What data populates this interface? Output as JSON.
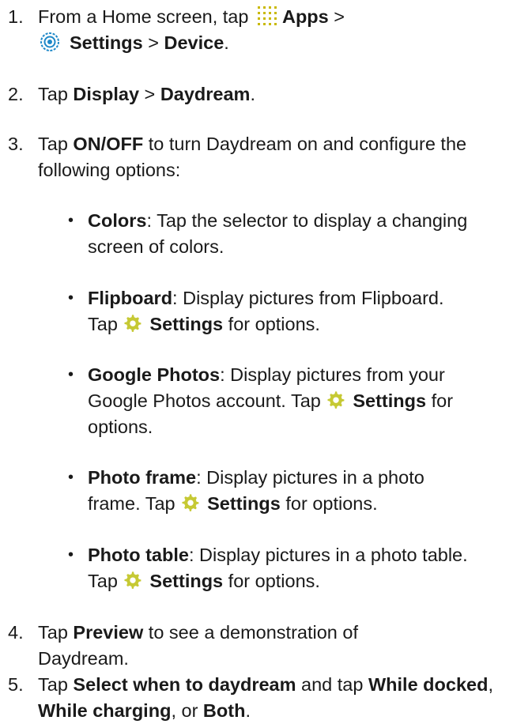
{
  "steps": [
    {
      "num": "1.",
      "line1_pre": "From a Home screen, tap",
      "apps_label": "Apps",
      "sep1": " >",
      "settings_label": "Settings",
      "sep2": " > ",
      "device_label": "Device",
      "period": ".",
      "apps_icon": "apps-grid-icon",
      "settings_icon": "settings-gear-icon"
    },
    {
      "num": "2.",
      "pre": "Tap ",
      "display_label": "Display",
      "sep": " > ",
      "daydream_label": "Daydream",
      "period": "."
    },
    {
      "num": "3.",
      "pre": "Tap ",
      "onoff_label": "ON/OFF",
      "post": " to turn Daydream on and configure the following options:"
    },
    {
      "num": "4.",
      "pre": "Tap ",
      "preview_label": "Preview",
      "post": " to see a demonstration of Daydream."
    },
    {
      "num": "5.",
      "pre": "Tap ",
      "select_label": "Select when to daydream",
      "mid": " and tap ",
      "docked_label": "While docked",
      "comma1": ", ",
      "charging_label": "While charging",
      "comma2": ", or ",
      "both_label": "Both",
      "period": "."
    }
  ],
  "options": [
    {
      "term": "Colors",
      "desc": ": Tap the selector to display a changing screen of colors."
    },
    {
      "term": "Flipboard",
      "desc": ": Display pictures from Flipboard.",
      "tap": "Tap ",
      "settings": "Settings",
      "after": " for options."
    },
    {
      "term": "Google Photos",
      "desc1": ": Display pictures from your",
      "desc2": "Google Photos account. Tap ",
      "settings": "Settings",
      "after1": " for",
      "after2": "options."
    },
    {
      "term": "Photo frame",
      "desc1": ": Display pictures in a photo",
      "desc2": "frame. Tap ",
      "settings": "Settings",
      "after": " for options."
    },
    {
      "term": "Photo table",
      "desc": ": Display pictures in a photo table.",
      "tap": "Tap ",
      "settings": "Settings",
      "after": " for options."
    }
  ],
  "icons": {
    "bullet": "•",
    "settings_small": "settings-cog-icon"
  },
  "colors": {
    "text": "#1a1a1a",
    "apps_icon": "#c9b900",
    "settings_icon_ring": "#1e88c8",
    "cog": "#c6c934"
  }
}
